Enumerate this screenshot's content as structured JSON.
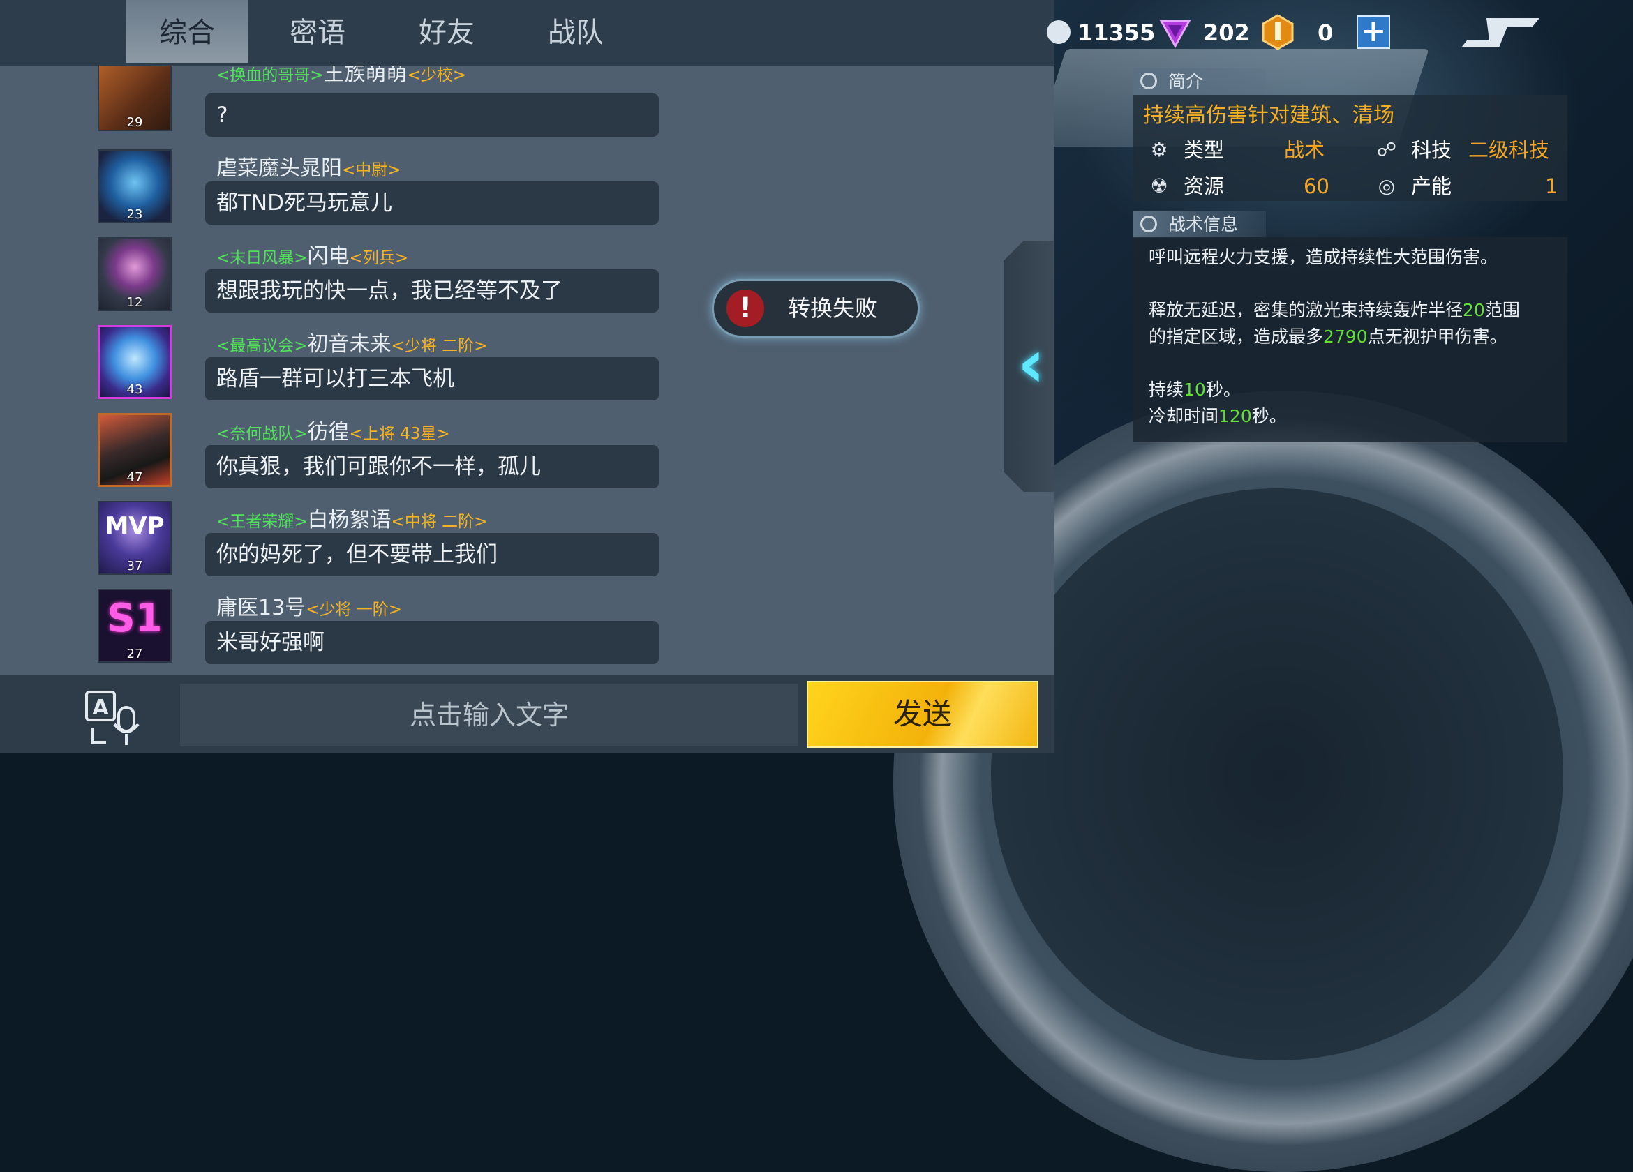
{
  "tabs": [
    {
      "label": "综合",
      "active": true
    },
    {
      "label": "密语",
      "active": false
    },
    {
      "label": "好友",
      "active": false
    },
    {
      "label": "战队",
      "active": false
    }
  ],
  "messages": [
    {
      "guild": "<换血的哥哥>",
      "name": "王族萌萌",
      "rank": "<少校>",
      "level": "29",
      "text": "?"
    },
    {
      "guild": "",
      "name": "虐菜魔头晁阳",
      "rank": "<中尉>",
      "level": "23",
      "text": "都TND死马玩意儿"
    },
    {
      "guild": "<末日风暴>",
      "name": "闪电",
      "rank": "<列兵>",
      "level": "12",
      "text": "想跟我玩的快一点，我已经等不及了"
    },
    {
      "guild": "<最高议会>",
      "name": "初音未来",
      "rank": "<少将 二阶>",
      "level": "43",
      "text": "路盾一群可以打三本飞机"
    },
    {
      "guild": "<奈何战队>",
      "name": "彷徨",
      "rank": "<上将 43星>",
      "level": "47",
      "text": "你真狠，我们可跟你不一样，孤儿"
    },
    {
      "guild": "<王者荣耀>",
      "name": "白杨絮语",
      "rank": "<中将 二阶>",
      "level": "37",
      "text": "你的妈死了，但不要带上我们"
    },
    {
      "guild": "",
      "name": "庸医13号",
      "rank": "<少将 一阶>",
      "level": "27",
      "text": "米哥好强啊"
    }
  ],
  "input": {
    "placeholder": "点击输入文字"
  },
  "send_label": "发送",
  "toast": {
    "text": "转换失败",
    "icon": "warning-icon"
  },
  "resources": {
    "credits": "11355",
    "gems": "202",
    "medals": "0"
  },
  "info": {
    "intro_header": "简介",
    "intro_title": "持续高伤害针对建筑、清场",
    "type_label": "类型",
    "type_value": "战术",
    "tech_label": "科技",
    "tech_value": "二级科技",
    "resource_label": "资源",
    "resource_value": "60",
    "power_label": "产能",
    "power_value": "1",
    "tactic_header": "战术信息",
    "desc_line1": "呼叫远程火力支援，造成持续性大范围伤害。",
    "desc_line2a": "释放无延迟，密集的激光束持续轰炸半径",
    "desc_radius": "20",
    "desc_line2b": "范围",
    "desc_line3a": "的指定区域，造成最多",
    "desc_damage": "2790",
    "desc_line3b": "点无视护甲伤害。",
    "desc_dur_a": "持续",
    "desc_duration": "10",
    "desc_dur_b": "秒。",
    "desc_cd_a": "冷却时间",
    "desc_cooldown": "120",
    "desc_cd_b": "秒。"
  },
  "colors": {
    "accent_orange": "#f5a623",
    "guild_green": "#51e05a",
    "send_yellow": "#f3b20a",
    "glow_cyan": "#5fe8ff"
  }
}
